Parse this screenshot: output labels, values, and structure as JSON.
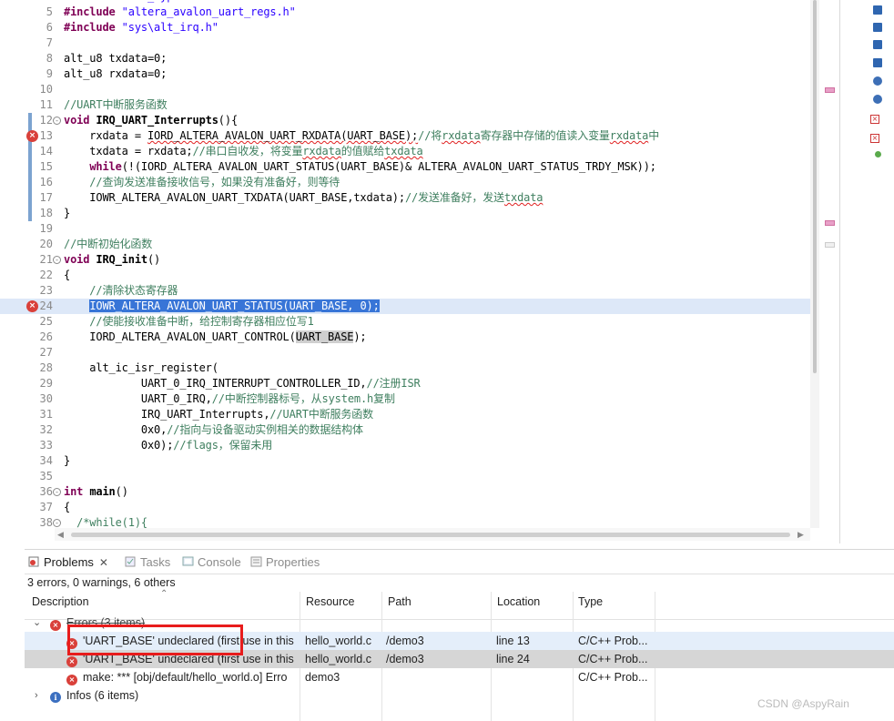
{
  "editor": {
    "lines": [
      {
        "n": "6",
        "code": [
          {
            "t": "#include ",
            "c": "pp"
          },
          {
            "t": "\"sys\\alt_irq.h\"",
            "c": "str"
          }
        ]
      },
      {
        "n": "7",
        "code": []
      },
      {
        "n": "8",
        "code": [
          {
            "t": "alt_u8 txdata=0;",
            "c": ""
          }
        ]
      },
      {
        "n": "9",
        "code": [
          {
            "t": "alt_u8 rxdata=0;",
            "c": ""
          }
        ]
      },
      {
        "n": "10",
        "code": []
      },
      {
        "n": "11",
        "code": [
          {
            "t": "//UART中断服务函数",
            "c": "cm"
          }
        ]
      },
      {
        "n": "12",
        "fold": "-",
        "bar": true,
        "code": [
          {
            "t": "void ",
            "c": "kw"
          },
          {
            "t": "IRQ_UART_Interrupts",
            "c": "fn"
          },
          {
            "t": "(){",
            "c": ""
          }
        ]
      },
      {
        "n": "13",
        "error": true,
        "bar": true,
        "code": [
          {
            "t": "    rxdata = ",
            "c": ""
          },
          {
            "t": "IORD_ALTERA_AVALON_UART_RXDATA(UART_BASE);",
            "c": "err"
          },
          {
            "t": "//将",
            "c": "cm"
          },
          {
            "t": "rxdata",
            "c": "cm err"
          },
          {
            "t": "寄存器中存储的值读入变量",
            "c": "cm"
          },
          {
            "t": "rxdata",
            "c": "cm err"
          },
          {
            "t": "中",
            "c": "cm"
          }
        ]
      },
      {
        "n": "14",
        "bar": true,
        "code": [
          {
            "t": "    txdata = rxdata;",
            "c": ""
          },
          {
            "t": "//串口自收发，将变量",
            "c": "cm"
          },
          {
            "t": "rxdata",
            "c": "cm err"
          },
          {
            "t": "的值赋给",
            "c": "cm"
          },
          {
            "t": "txdata",
            "c": "cm err"
          }
        ]
      },
      {
        "n": "15",
        "bar": true,
        "code": [
          {
            "t": "    ",
            "c": ""
          },
          {
            "t": "while",
            "c": "kw"
          },
          {
            "t": "(!(IORD_ALTERA_AVALON_UART_STATUS(UART_BASE)& ALTERA_AVALON_UART_STATUS_TRDY_MSK));",
            "c": ""
          }
        ]
      },
      {
        "n": "16",
        "bar": true,
        "code": [
          {
            "t": "    //查询发送准备接收信号，如果没有准备好，则等待",
            "c": "cm"
          }
        ]
      },
      {
        "n": "17",
        "bar": true,
        "code": [
          {
            "t": "    IOWR_ALTERA_AVALON_UART_TXDATA(UART_BASE,txdata);",
            "c": ""
          },
          {
            "t": "//发送准备好，发送",
            "c": "cm"
          },
          {
            "t": "txdata",
            "c": "cm err"
          }
        ]
      },
      {
        "n": "18",
        "bar": true,
        "code": [
          {
            "t": "}",
            "c": ""
          }
        ]
      },
      {
        "n": "19",
        "code": []
      },
      {
        "n": "20",
        "code": [
          {
            "t": "//中断初始化函数",
            "c": "cm"
          }
        ]
      },
      {
        "n": "21",
        "fold": "-",
        "code": [
          {
            "t": "void ",
            "c": "kw"
          },
          {
            "t": "IRQ_init",
            "c": "fn"
          },
          {
            "t": "()",
            "c": ""
          }
        ]
      },
      {
        "n": "22",
        "code": [
          {
            "t": "{",
            "c": ""
          }
        ]
      },
      {
        "n": "23",
        "code": [
          {
            "t": "    //清除状态寄存器",
            "c": "cm"
          }
        ]
      },
      {
        "n": "24",
        "error": true,
        "selected": true,
        "code": [
          {
            "t": "    ",
            "c": ""
          },
          {
            "t": "IOWR_ALTERA_AVALON_UART_STATUS(UART_BASE, 0);",
            "c": "sel"
          }
        ]
      },
      {
        "n": "25",
        "code": [
          {
            "t": "    //使能接收准备中断，给控制寄存器相应位写1",
            "c": "cm"
          }
        ]
      },
      {
        "n": "26",
        "code": [
          {
            "t": "    IORD_ALTERA_AVALON_UART_CONTROL(",
            "c": ""
          },
          {
            "t": "UART_BASE",
            "c": "hl"
          },
          {
            "t": ");",
            "c": ""
          }
        ]
      },
      {
        "n": "27",
        "code": []
      },
      {
        "n": "28",
        "code": [
          {
            "t": "    alt_ic_isr_register(",
            "c": ""
          }
        ]
      },
      {
        "n": "29",
        "code": [
          {
            "t": "            UART_0_IRQ_INTERRUPT_CONTROLLER_ID,",
            "c": ""
          },
          {
            "t": "//注册ISR",
            "c": "cm"
          }
        ]
      },
      {
        "n": "30",
        "code": [
          {
            "t": "            UART_0_IRQ,",
            "c": ""
          },
          {
            "t": "//中断控制器标号，从system.h复制",
            "c": "cm"
          }
        ]
      },
      {
        "n": "31",
        "code": [
          {
            "t": "            IRQ_UART_Interrupts,",
            "c": ""
          },
          {
            "t": "//UART中断服务函数",
            "c": "cm"
          }
        ]
      },
      {
        "n": "32",
        "code": [
          {
            "t": "            0x0,",
            "c": ""
          },
          {
            "t": "//指向与设备驱动实例相关的数据结构体",
            "c": "cm"
          }
        ]
      },
      {
        "n": "33",
        "code": [
          {
            "t": "            0x0);",
            "c": ""
          },
          {
            "t": "//flags，保留未用",
            "c": "cm"
          }
        ]
      },
      {
        "n": "34",
        "code": [
          {
            "t": "}",
            "c": ""
          }
        ]
      },
      {
        "n": "35",
        "code": []
      },
      {
        "n": "36",
        "fold": "-",
        "code": [
          {
            "t": "int ",
            "c": "kw"
          },
          {
            "t": "main",
            "c": "fn"
          },
          {
            "t": "()",
            "c": ""
          }
        ]
      },
      {
        "n": "37",
        "code": [
          {
            "t": "{",
            "c": ""
          }
        ]
      },
      {
        "n": "38",
        "fold": "-",
        "code": [
          {
            "t": "  /*while(1){",
            "c": "cm"
          }
        ]
      }
    ],
    "first_partial": {
      "code": [
        {
          "t": "#include ",
          "c": "pp"
        },
        {
          "t": "\"alt_types.h\"",
          "c": "str"
        }
      ]
    },
    "second_partial": {
      "n": "5",
      "code": [
        {
          "t": "#include ",
          "c": "pp"
        },
        {
          "t": "\"altera_avalon_uart_regs.h\"",
          "c": "str"
        }
      ]
    }
  },
  "problems": {
    "tabs": [
      {
        "label": "Problems",
        "icon": "problems-icon",
        "active": true,
        "close": "✕"
      },
      {
        "label": "Tasks",
        "icon": "tasks-icon",
        "active": false
      },
      {
        "label": "Console",
        "icon": "console-icon",
        "active": false
      },
      {
        "label": "Properties",
        "icon": "properties-icon",
        "active": false
      }
    ],
    "summary": "3 errors, 0 warnings, 6 others",
    "columns": [
      "Description",
      "Resource",
      "Path",
      "Location",
      "Type"
    ],
    "errors_group": "Errors (3 items)",
    "rows": [
      {
        "desc": "'UART_BASE' undeclared (first use in this",
        "resource": "hello_world.c",
        "path": "/demo3",
        "location": "line 13",
        "type": "C/C++ Prob..."
      },
      {
        "desc": "'UART_BASE' undeclared (first use in this",
        "resource": "hello_world.c",
        "path": "/demo3",
        "location": "line 24",
        "type": "C/C++ Prob..."
      },
      {
        "desc": "make: *** [obj/default/hello_world.o] Erro",
        "resource": "demo3",
        "path": "",
        "location": "",
        "type": "C/C++ Prob..."
      }
    ],
    "infos_group": "Infos (6 items)"
  },
  "watermark": "CSDN @AspyRain",
  "colors": {
    "error": "#d9403a",
    "selection": "#3875d7",
    "highlight_box": "#e81c1c"
  }
}
